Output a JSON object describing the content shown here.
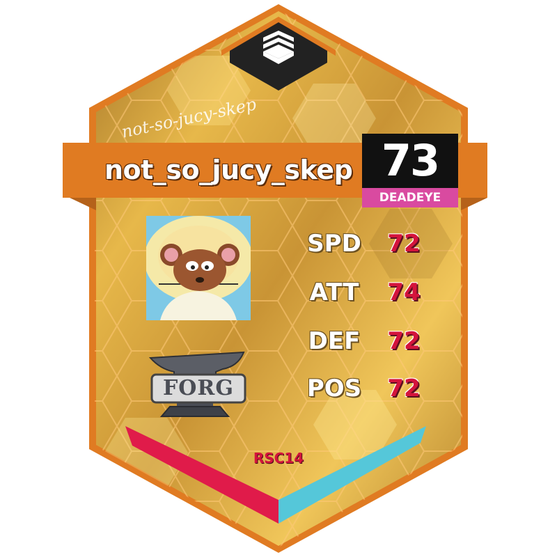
{
  "player": {
    "name": "not_so_jucy_skep",
    "signature": "not-so-jucy-skep",
    "rating": "73",
    "tier": "DEADEYE",
    "avatar": "mouse-avatar-icon"
  },
  "stats": [
    {
      "label": "SPD",
      "value": "72"
    },
    {
      "label": "ATT",
      "value": "74"
    },
    {
      "label": "DEF",
      "value": "72"
    },
    {
      "label": "POS",
      "value": "72"
    }
  ],
  "team": {
    "name": "FORG",
    "logo": "anvil-icon"
  },
  "season": "RSC14",
  "colors": {
    "card_gold": "#d9a53a",
    "border_orange": "#e07b22",
    "name_banner": "#e07b22",
    "rating_box": "#111111",
    "tier_badge": "#d94aa0",
    "stat_value": "#d4143c",
    "stripe_red": "#e01b4a",
    "stripe_cyan": "#55c7d9"
  }
}
